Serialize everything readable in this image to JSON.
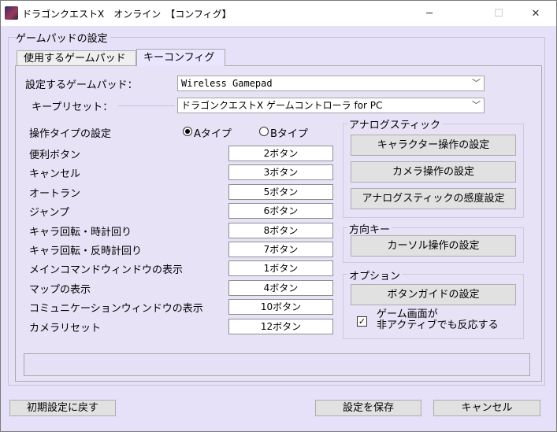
{
  "window": {
    "title": "ドラゴンクエストX　オンライン　【コンフィグ】",
    "min_icon": "─",
    "max_icon": "☐",
    "close_icon": "✕"
  },
  "group_title": "ゲームパッドの設定",
  "tabs": [
    {
      "label": "使用するゲームパッド",
      "active": false
    },
    {
      "label": "キーコンフィグ",
      "active": true
    }
  ],
  "gamepad": {
    "label": "設定するゲームパッド：",
    "value": "Wireless Gamepad"
  },
  "preset": {
    "label": "キープリセット：",
    "value": "ドラゴンクエストX ゲームコントローラ for PC"
  },
  "op_type": {
    "label": "操作タイプの設定",
    "option_a": "Aタイプ",
    "option_b": "Bタイプ",
    "selected": "A"
  },
  "keys": [
    {
      "label": "便利ボタン",
      "value": "2ボタン"
    },
    {
      "label": "キャンセル",
      "value": "3ボタン"
    },
    {
      "label": "オートラン",
      "value": "5ボタン"
    },
    {
      "label": "ジャンプ",
      "value": "6ボタン"
    },
    {
      "label": "キャラ回転・時計回り",
      "value": "8ボタン"
    },
    {
      "label": "キャラ回転・反時計回り",
      "value": "7ボタン"
    },
    {
      "label": "メインコマンドウィンドウの表示",
      "value": "1ボタン"
    },
    {
      "label": "マップの表示",
      "value": "4ボタン"
    },
    {
      "label": "コミュニケーションウィンドウの表示",
      "value": "10ボタン"
    },
    {
      "label": "カメラリセット",
      "value": "12ボタン"
    }
  ],
  "analog": {
    "title": "アナログスティック",
    "buttons": [
      "キャラクター操作の設定",
      "カメラ操作の設定",
      "アナログスティックの感度設定"
    ]
  },
  "direction": {
    "title": "方向キー",
    "button": "カーソル操作の設定"
  },
  "options": {
    "title": "オプション",
    "button": "ボタンガイドの設定",
    "checkbox_line1": "ゲーム画面が",
    "checkbox_line2": "非アクティブでも反応する",
    "checked": true,
    "check_mark": "✓"
  },
  "footer": {
    "reset": "初期設定に戻す",
    "save": "設定を保存",
    "cancel": "キャンセル"
  }
}
